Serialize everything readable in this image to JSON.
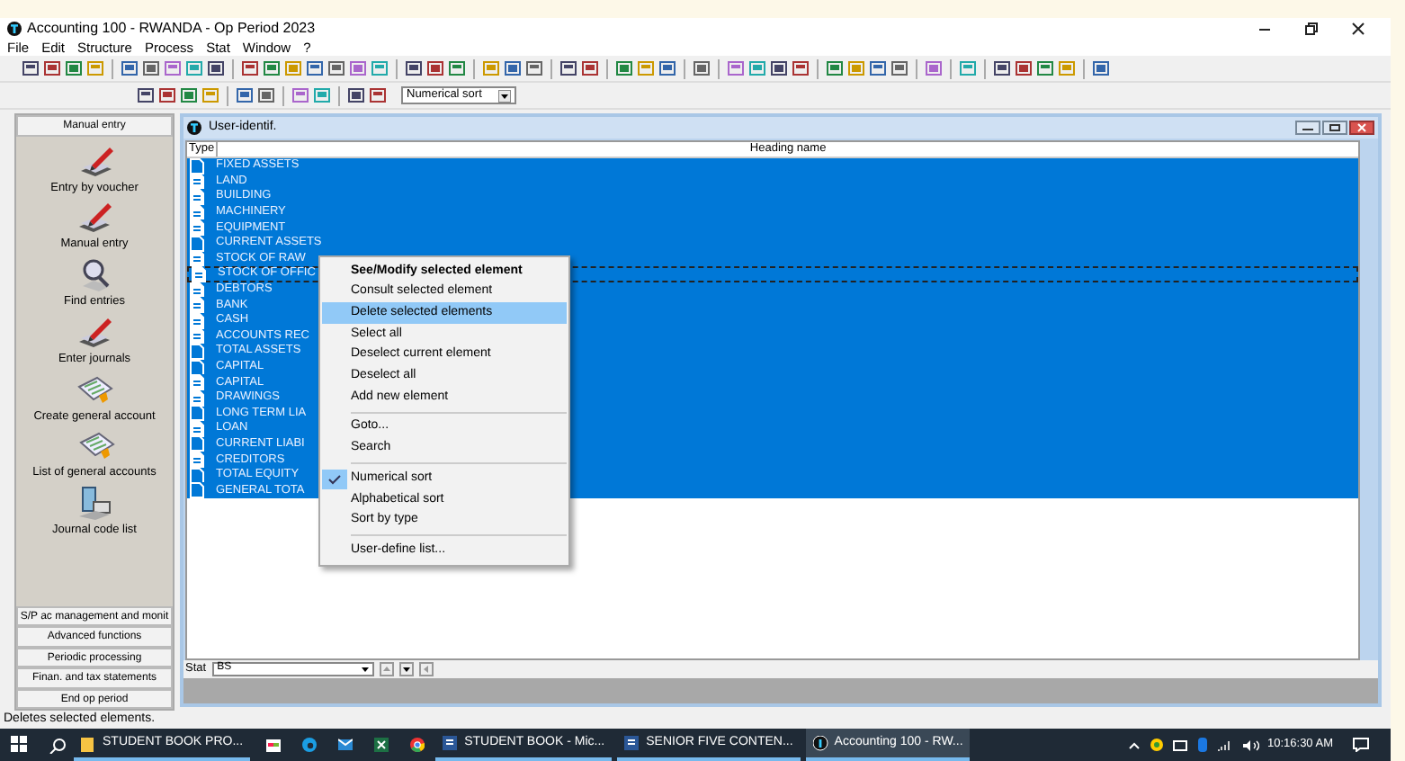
{
  "window": {
    "title": "Accounting 100 - RWANDA - Op Period 2023"
  },
  "menu_bar": [
    "File",
    "Edit",
    "Structure",
    "Process",
    "Stat",
    "Window",
    "?"
  ],
  "toolbar": {
    "sort_select": "Numerical sort"
  },
  "sidebar": {
    "header": "Manual entry",
    "items": [
      {
        "label": "Entry by voucher",
        "kind": "pen"
      },
      {
        "label": "Manual entry",
        "kind": "pen"
      },
      {
        "label": "Find entries",
        "kind": "search"
      },
      {
        "label": "Enter journals",
        "kind": "pen"
      },
      {
        "label": "Create general account",
        "kind": "sheet"
      },
      {
        "label": "List of general accounts",
        "kind": "sheet"
      },
      {
        "label": "Journal code list",
        "kind": "network"
      }
    ],
    "sections": [
      "S/P ac management and monit",
      "Advanced functions",
      "Periodic processing",
      "Finan. and tax statements",
      "End op period"
    ]
  },
  "child_window": {
    "title": "User-identif.",
    "columns": [
      "Type",
      "Heading name"
    ],
    "rows": [
      {
        "name": "FIXED ASSETS",
        "kind": "heading",
        "selected": true,
        "focused": false
      },
      {
        "name": "LAND",
        "kind": "account",
        "selected": true,
        "focused": false
      },
      {
        "name": "BUILDING",
        "kind": "account",
        "selected": true,
        "focused": false
      },
      {
        "name": "MACHINERY",
        "kind": "account",
        "selected": true,
        "focused": false
      },
      {
        "name": "EQUIPMENT",
        "kind": "account",
        "selected": true,
        "focused": false
      },
      {
        "name": "CURRENT ASSETS",
        "kind": "heading",
        "selected": true,
        "focused": false
      },
      {
        "name": "STOCK OF RAW",
        "kind": "account",
        "selected": true,
        "focused": false
      },
      {
        "name": "STOCK OF OFFIC",
        "kind": "account",
        "selected": true,
        "focused": true
      },
      {
        "name": "DEBTORS",
        "kind": "account",
        "selected": true,
        "focused": false
      },
      {
        "name": "BANK",
        "kind": "account",
        "selected": true,
        "focused": false
      },
      {
        "name": "CASH",
        "kind": "account",
        "selected": true,
        "focused": false
      },
      {
        "name": "ACCOUNTS REC",
        "kind": "account",
        "selected": true,
        "focused": false
      },
      {
        "name": "TOTAL ASSETS",
        "kind": "heading",
        "selected": true,
        "focused": false
      },
      {
        "name": "CAPITAL",
        "kind": "heading",
        "selected": true,
        "focused": false
      },
      {
        "name": "CAPITAL",
        "kind": "account",
        "selected": true,
        "focused": false
      },
      {
        "name": "DRAWINGS",
        "kind": "account",
        "selected": true,
        "focused": false
      },
      {
        "name": "LONG TERM LIA",
        "kind": "heading",
        "selected": true,
        "focused": false
      },
      {
        "name": "LOAN",
        "kind": "account",
        "selected": true,
        "focused": false
      },
      {
        "name": "CURRENT LIABI",
        "kind": "heading",
        "selected": true,
        "focused": false
      },
      {
        "name": "CREDITORS",
        "kind": "account",
        "selected": true,
        "focused": false
      },
      {
        "name": "TOTAL EQUITY",
        "kind": "heading",
        "selected": true,
        "focused": false
      },
      {
        "name": "GENERAL TOTA",
        "kind": "heading",
        "selected": true,
        "focused": false
      }
    ],
    "stat_label": "Stat",
    "stat_value": "BS"
  },
  "context_menu": [
    {
      "kind": "item",
      "label": "See/Modify selected element",
      "default": true,
      "selected": false,
      "checked": false
    },
    {
      "kind": "item",
      "label": "Consult selected element",
      "default": false,
      "selected": false,
      "checked": false
    },
    {
      "kind": "item",
      "label": "Delete selected elements",
      "default": false,
      "selected": true,
      "checked": false
    },
    {
      "kind": "item",
      "label": "Select all",
      "default": false,
      "selected": false,
      "checked": false
    },
    {
      "kind": "item",
      "label": "Deselect current element",
      "default": false,
      "selected": false,
      "checked": false
    },
    {
      "kind": "item",
      "label": "Deselect all",
      "default": false,
      "selected": false,
      "checked": false
    },
    {
      "kind": "item",
      "label": "Add new element",
      "default": false,
      "selected": false,
      "checked": false
    },
    {
      "kind": "separator"
    },
    {
      "kind": "item",
      "label": "Goto...",
      "default": false,
      "selected": false,
      "checked": false
    },
    {
      "kind": "item",
      "label": "Search",
      "default": false,
      "selected": false,
      "checked": false
    },
    {
      "kind": "separator"
    },
    {
      "kind": "item",
      "label": "Numerical sort",
      "default": false,
      "selected": false,
      "checked": true
    },
    {
      "kind": "item",
      "label": "Alphabetical sort",
      "default": false,
      "selected": false,
      "checked": false
    },
    {
      "kind": "item",
      "label": "Sort by type",
      "default": false,
      "selected": false,
      "checked": false
    },
    {
      "kind": "separator"
    },
    {
      "kind": "item",
      "label": "User-define list...",
      "default": false,
      "selected": false,
      "checked": false
    }
  ],
  "status_bar": "Deletes selected elements.",
  "taskbar": {
    "tasks": [
      {
        "label": "STUDENT BOOK PRO...",
        "kind": "folder",
        "active": false
      },
      {
        "label": "STUDENT BOOK - Mic...",
        "kind": "word",
        "active": false
      },
      {
        "label": "SENIOR FIVE CONTEN...",
        "kind": "word",
        "active": false
      },
      {
        "label": "Accounting 100 - RW...",
        "kind": "app",
        "active": true
      }
    ],
    "clock": "10:16:30 AM"
  }
}
